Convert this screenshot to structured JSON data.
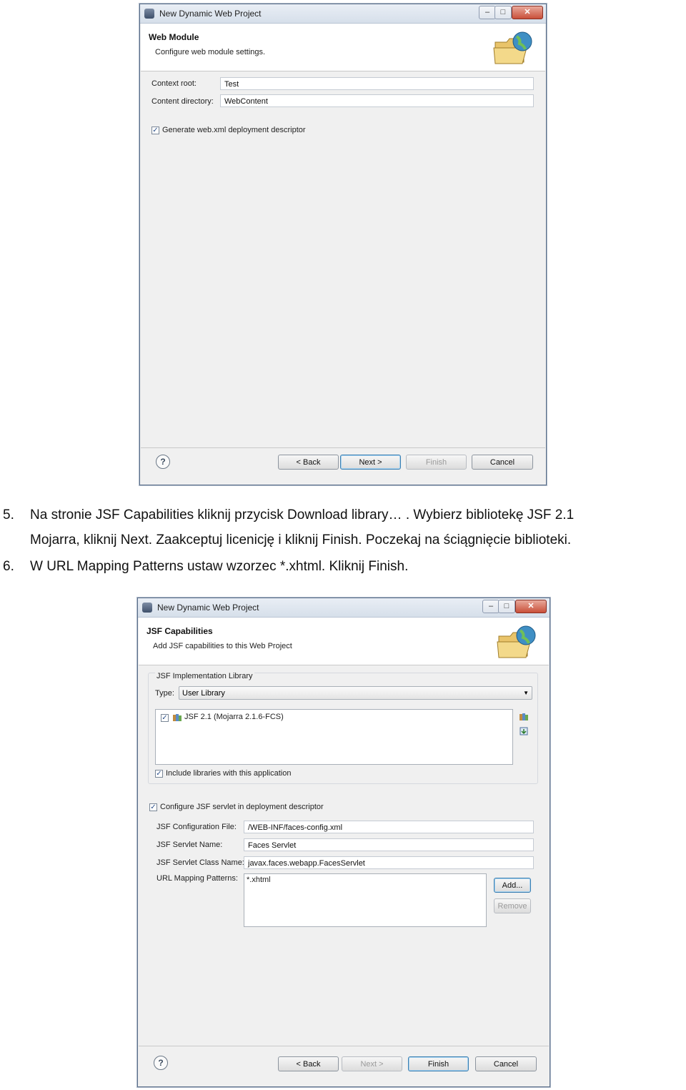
{
  "window1": {
    "title": "New Dynamic Web Project",
    "header_title": "Web Module",
    "header_desc": "Configure web module settings.",
    "context_root_label": "Context root:",
    "context_root_value": "Test",
    "content_dir_label": "Content directory:",
    "content_dir_value": "WebContent",
    "generate_label": "Generate web.xml deployment descriptor",
    "generate_checked": "✓",
    "back_label": "< Back",
    "next_label": "Next >",
    "finish_label": "Finish",
    "cancel_label": "Cancel",
    "help_glyph": "?"
  },
  "captions": {
    "item5_num": "5.",
    "item5_line1": "Na stronie JSF Capabilities kliknij przycisk Download library… . Wybierz bibliotekę JSF 2.1",
    "item5_line2": "Mojarra, kliknij Next. Zaakceptuj licenicję i kliknij Finish. Poczekaj na ściągnięcie biblioteki.",
    "item6_num": "6.",
    "item6_line1": "W URL Mapping Patterns ustaw wzorzec *.xhtml. Kliknij Finish."
  },
  "window2": {
    "title": "New Dynamic Web Project",
    "header_title": "JSF Capabilities",
    "header_desc": "Add JSF capabilities to this Web Project",
    "impl_group_label": "JSF Implementation Library",
    "type_label": "Type:",
    "type_value": "User Library",
    "library_item": "JSF 2.1 (Mojarra 2.1.6-FCS)",
    "library_checked": "✓",
    "include_label": "Include libraries with this application",
    "include_checked": "✓",
    "configure_label": "Configure JSF servlet in deployment descriptor",
    "configure_checked": "✓",
    "config_file_label": "JSF Configuration File:",
    "config_file_value": "/WEB-INF/faces-config.xml",
    "servlet_name_label": "JSF Servlet Name:",
    "servlet_name_value": "Faces Servlet",
    "servlet_class_label": "JSF Servlet Class Name:",
    "servlet_class_value": "javax.faces.webapp.FacesServlet",
    "url_patterns_label": "URL Mapping Patterns:",
    "url_pattern_item": "*.xhtml",
    "add_label": "Add...",
    "remove_label": "Remove",
    "back_label": "< Back",
    "next_label": "Next >",
    "finish_label": "Finish",
    "cancel_label": "Cancel",
    "help_glyph": "?"
  },
  "icons": {
    "minimize": "–",
    "maximize": "□",
    "close": "✕",
    "dropdown": "▼"
  }
}
